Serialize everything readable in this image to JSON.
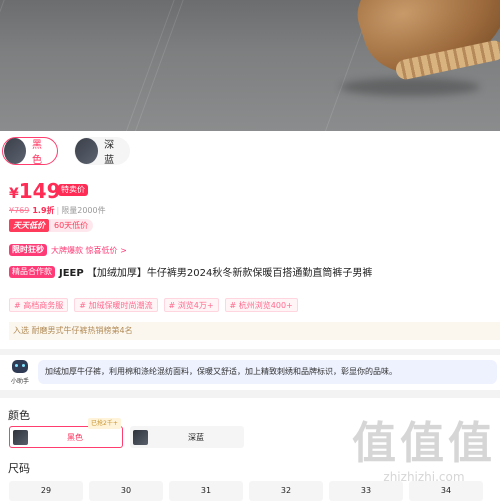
{
  "colors": {
    "accent": "#ff2c55",
    "tag_bg": "#ff3b77",
    "desc_bg": "#eef2ff",
    "rank_text": "#b28a55"
  },
  "swatches": [
    {
      "label": "黑色",
      "selected": true
    },
    {
      "label": "深蓝",
      "selected": false
    }
  ],
  "price": {
    "currency": "¥",
    "value": "149",
    "badge": "特卖价"
  },
  "sub": {
    "original": "¥769",
    "discount": "1.9折",
    "limit": "限量2000件"
  },
  "daily": {
    "badge": "天天低价",
    "chip": "60天低价"
  },
  "limited": {
    "badge": "限时狂秒",
    "text": "大牌爆款 惊喜低价 >"
  },
  "title": {
    "badge": "精品合作款",
    "brand": "JEEP",
    "text": "【加绒加厚】牛仔裤男2024秋冬新款保暖百搭通勤直筒裤子男裤"
  },
  "hashtags": [
    "# 高档商务服",
    "# 加绒保暖时尚潮流",
    "# 浏览4万+",
    "# 杭州浏览400+"
  ],
  "rank": "入选 耐磨男式牛仔裤热销榜第4名",
  "assistant": {
    "name": "小助手",
    "text": "加绒加厚牛仔裤，利用棉和涤纶混纺面料，保暖又舒适，加上精致刺绣和品牌标识，彰显你的品味。"
  },
  "options": {
    "color_label": "颜色",
    "sold_tag": "已抢2千+",
    "colors": [
      "黑色",
      "深蓝"
    ],
    "size_label": "尺码",
    "sizes": [
      "29",
      "30",
      "31",
      "32",
      "33",
      "34"
    ]
  },
  "watermark": {
    "big": "值值值",
    "small": "zhizhizhi.com"
  }
}
